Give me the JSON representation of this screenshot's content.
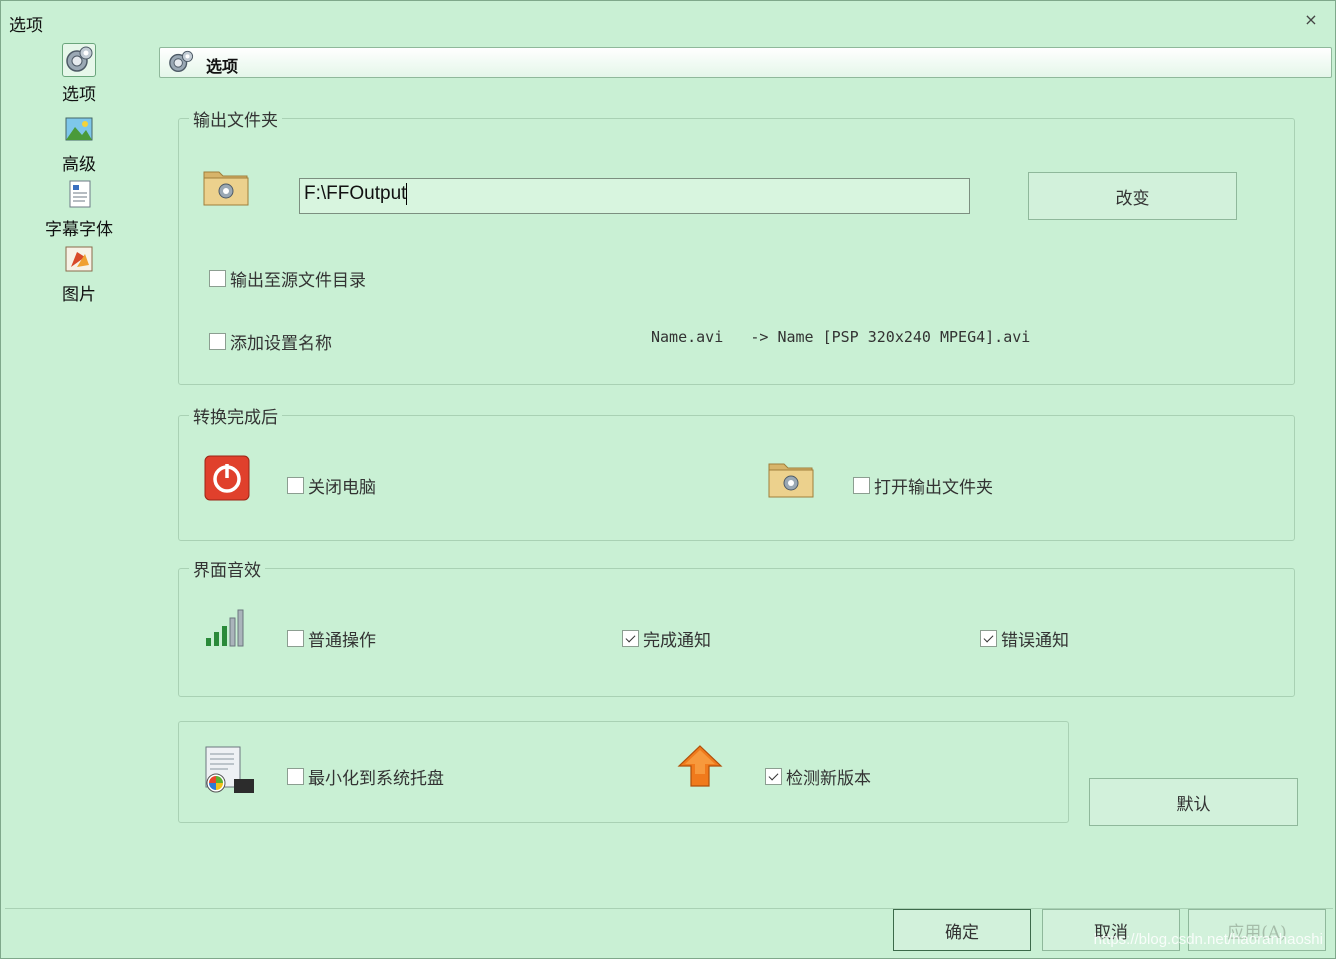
{
  "window": {
    "title": "选项",
    "close": "×"
  },
  "sidebar": {
    "items": [
      {
        "label": "选项",
        "icon": "options-icon",
        "active": true
      },
      {
        "label": "高级",
        "icon": "advanced-icon"
      },
      {
        "label": "字幕字体",
        "icon": "subtitle-font-icon"
      },
      {
        "label": "图片",
        "icon": "picture-icon"
      }
    ]
  },
  "header": {
    "title": "选项"
  },
  "output_folder": {
    "title": "输出文件夹",
    "path": "F:\\FFOutput",
    "change_label": "改变",
    "output_to_source": {
      "label": "输出至源文件目录",
      "checked": false
    },
    "add_setting_name": {
      "label": "添加设置名称",
      "checked": false
    },
    "example_src": "Name.avi",
    "example_arrow": "->",
    "example_dst": "Name [PSP 320x240 MPEG4].avi"
  },
  "after_convert": {
    "title": "转换完成后",
    "shutdown": {
      "label": "关闭电脑",
      "checked": false
    },
    "open_folder": {
      "label": "打开输出文件夹",
      "checked": false
    }
  },
  "sound": {
    "title": "界面音效",
    "normal": {
      "label": "普通操作",
      "checked": false
    },
    "done": {
      "label": "完成通知",
      "checked": true
    },
    "error": {
      "label": "错误通知",
      "checked": true
    }
  },
  "misc": {
    "minimize_tray": {
      "label": "最小化到系统托盘",
      "checked": false
    },
    "check_update": {
      "label": "检测新版本",
      "checked": true
    }
  },
  "buttons": {
    "default": "默认",
    "ok": "确定",
    "cancel": "取消",
    "apply": "应用(A)"
  },
  "watermark": "https://blog.csdn.net/haoranhaoshi",
  "colors": {
    "background": "#c9f0d4",
    "border": "#a9d1b4",
    "power_red": "#e0402c"
  }
}
